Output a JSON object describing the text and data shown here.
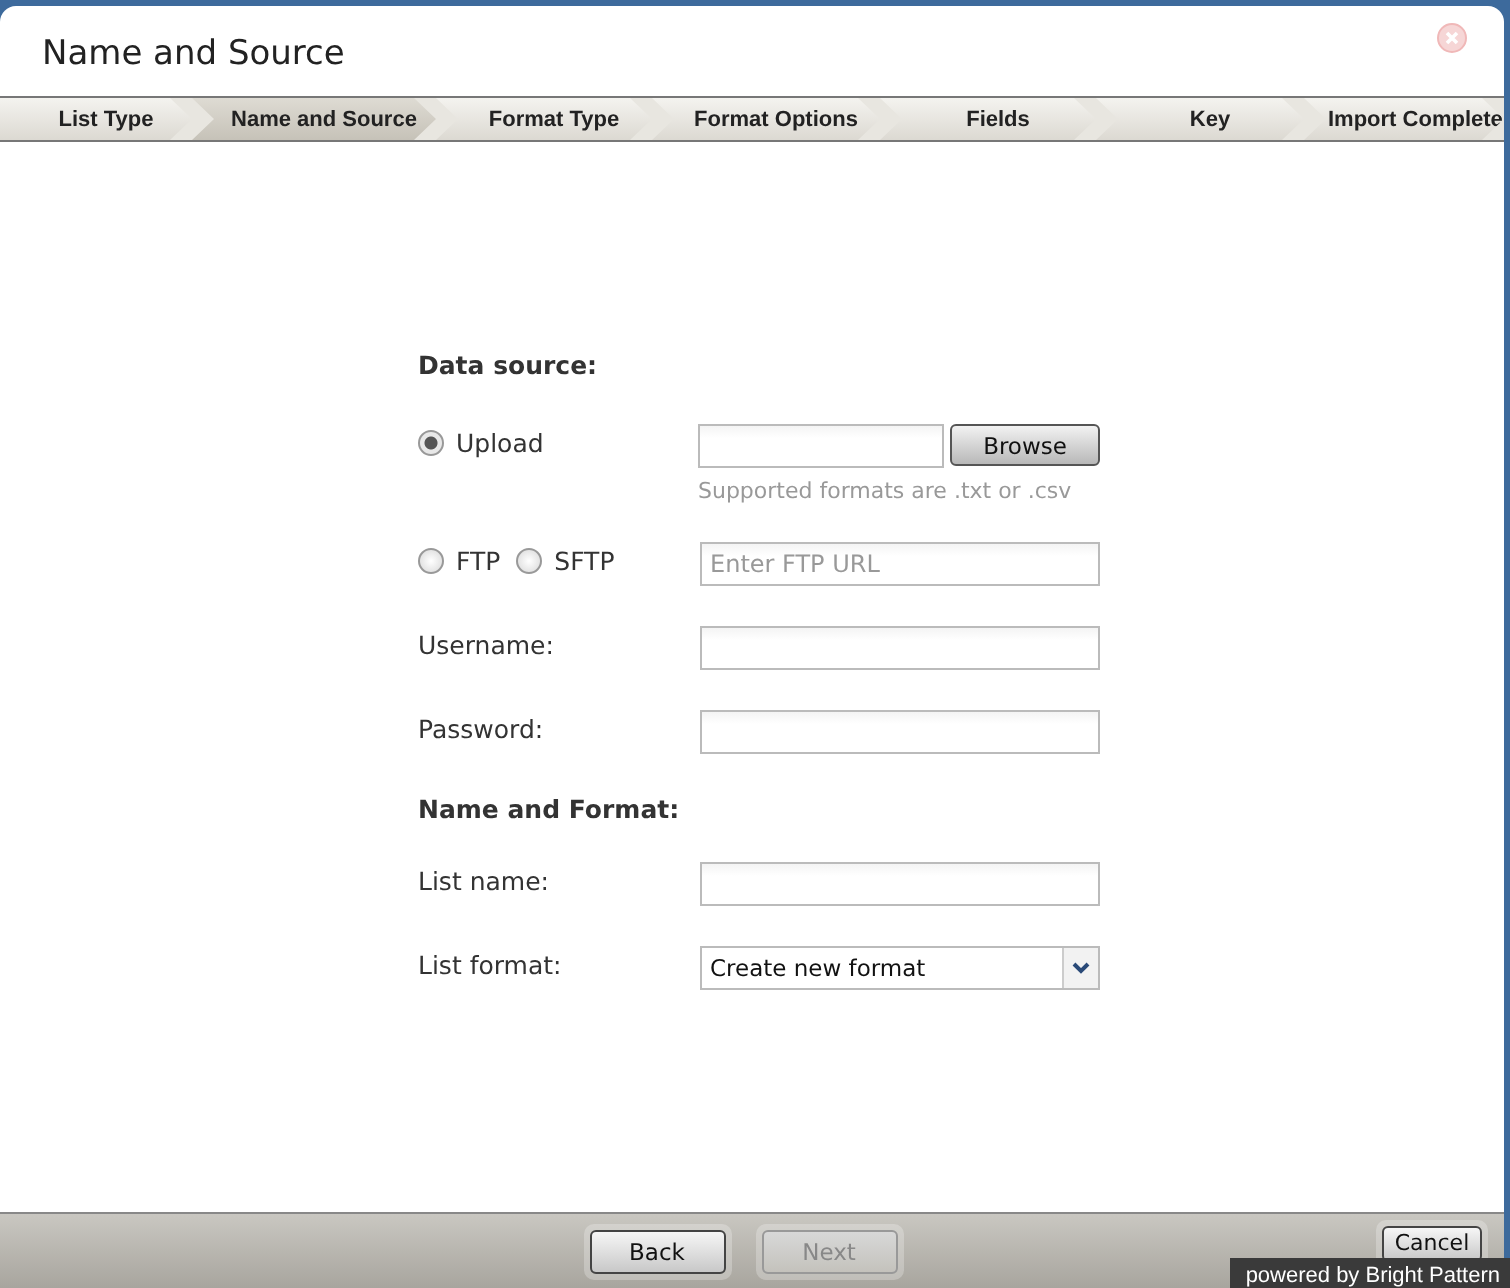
{
  "window": {
    "title": "Name and Source"
  },
  "steps": [
    {
      "label": "List Type",
      "selected": false
    },
    {
      "label": "Name and Source",
      "selected": true
    },
    {
      "label": "Format Type",
      "selected": false
    },
    {
      "label": "Format Options",
      "selected": false
    },
    {
      "label": "Fields",
      "selected": false
    },
    {
      "label": "Key",
      "selected": false
    },
    {
      "label": "Import Complete",
      "selected": false
    }
  ],
  "data_source": {
    "heading": "Data source:",
    "upload": {
      "label": "Upload",
      "selected": true,
      "browse": "Browse",
      "hint": "Supported formats are .txt or .csv"
    },
    "ftp": {
      "label": "FTP",
      "selected": false
    },
    "sftp": {
      "label": "SFTP",
      "selected": false
    },
    "ftp_url": {
      "placeholder": "Enter FTP URL"
    },
    "username": {
      "label": "Username:"
    },
    "password": {
      "label": "Password:"
    }
  },
  "name_and_format": {
    "heading": "Name and Format:",
    "list_name": {
      "label": "List name:"
    },
    "list_format": {
      "label": "List format:",
      "value": "Create new format"
    }
  },
  "footer": {
    "buttons": [
      {
        "label": "Back",
        "disabled": false
      },
      {
        "label": "Next",
        "disabled": true
      }
    ],
    "cancel": "Cancel",
    "badge": "powered by Bright Pattern"
  }
}
